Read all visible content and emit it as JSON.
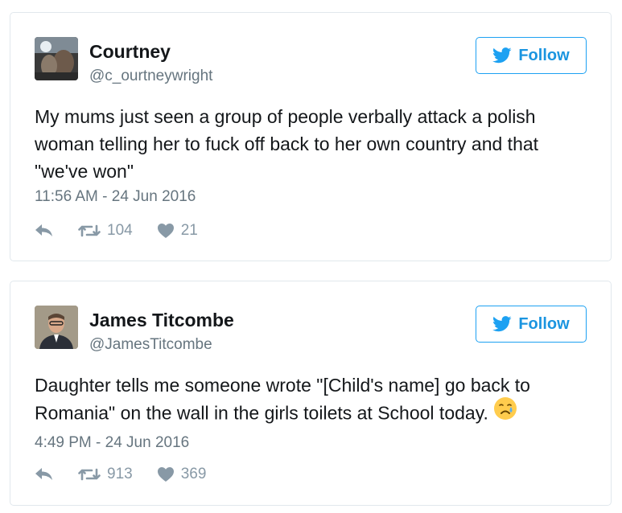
{
  "tweets": [
    {
      "author_name": "Courtney",
      "author_handle": "@c_ourtneywright",
      "follow_label": "Follow",
      "text": "My mums just seen a group of people verbally attack a polish woman telling her to fuck off back to her own country and that \"we've won\"",
      "timestamp": "11:56 AM - 24 Jun 2016",
      "retweets": "104",
      "likes": "21",
      "avatar_icon": "user-photo-icon"
    },
    {
      "author_name": "James Titcombe",
      "author_handle": "@JamesTitcombe",
      "follow_label": "Follow",
      "text": "Daughter tells me someone wrote \"[Child's name] go back to Romania\" on the wall in the girls toilets at School today.",
      "emoji_icon": "crying-face-icon",
      "timestamp": "4:49 PM - 24 Jun 2016",
      "retweets": "913",
      "likes": "369",
      "avatar_icon": "user-photo-icon"
    }
  ],
  "colors": {
    "accent": "#1da1f2",
    "muted": "#66757f",
    "icon": "#8899a6",
    "border": "#e1e8ed"
  }
}
